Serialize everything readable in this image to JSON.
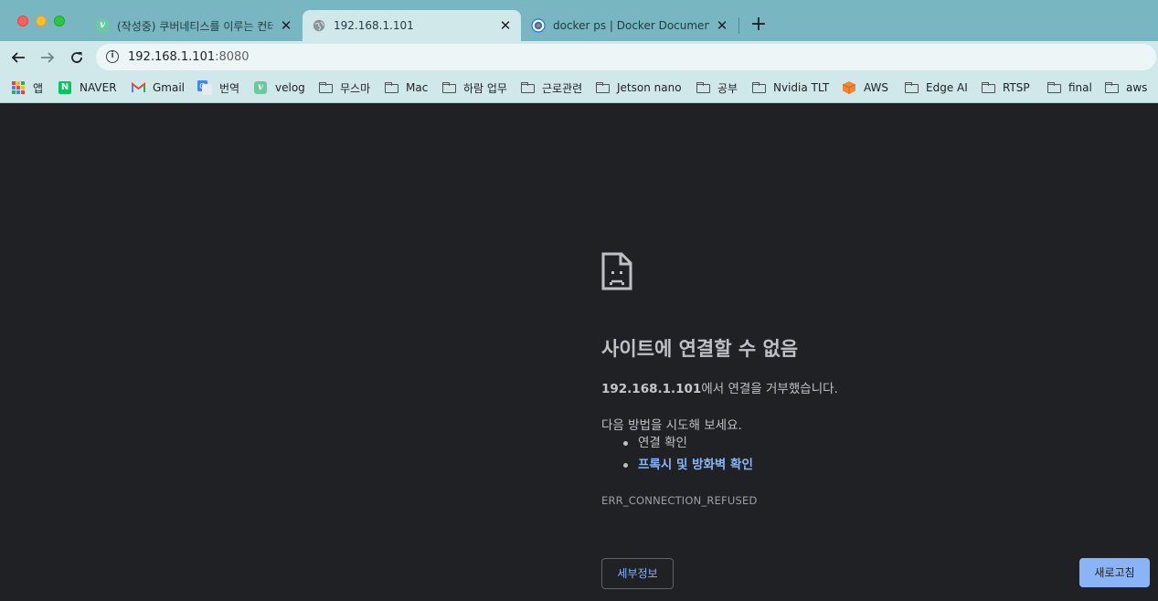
{
  "window": {
    "controls": [
      "close",
      "minimize",
      "zoom"
    ]
  },
  "tabs": [
    {
      "title": "(작성중) 쿠버네티스를 이루는 컨테이",
      "favicon": "velog-icon",
      "active": false
    },
    {
      "title": "192.168.1.101",
      "favicon": "globe-icon",
      "active": true
    },
    {
      "title": "docker ps | Docker Documenta",
      "favicon": "docker-docs-icon",
      "active": false
    }
  ],
  "toolbar": {
    "url_host": "192.168.1.101",
    "url_port": ":8080"
  },
  "bookmarks": [
    {
      "label": "앱",
      "icon": "apps-grid-icon"
    },
    {
      "label": "NAVER",
      "icon": "naver-icon"
    },
    {
      "label": "Gmail",
      "icon": "gmail-icon"
    },
    {
      "label": "번역",
      "icon": "google-translate-icon"
    },
    {
      "label": "velog",
      "icon": "velog-icon"
    },
    {
      "label": "무스마",
      "icon": "folder-icon"
    },
    {
      "label": "Mac",
      "icon": "folder-icon"
    },
    {
      "label": "하람 업무",
      "icon": "folder-icon"
    },
    {
      "label": "근로관련",
      "icon": "folder-icon"
    },
    {
      "label": "Jetson nano",
      "icon": "folder-icon"
    },
    {
      "label": "공부",
      "icon": "folder-icon"
    },
    {
      "label": "Nvidia TLT",
      "icon": "folder-icon"
    },
    {
      "label": "AWS",
      "icon": "aws-icon"
    },
    {
      "label": "Edge AI",
      "icon": "folder-icon"
    },
    {
      "label": "RTSP",
      "icon": "folder-icon"
    },
    {
      "label": "final",
      "icon": "folder-icon"
    },
    {
      "label": "aws",
      "icon": "folder-icon"
    }
  ],
  "error_page": {
    "icon": "sad-page-icon",
    "heading": "사이트에 연결할 수 없음",
    "host": "192.168.1.101",
    "desc_suffix": "에서 연결을 거부했습니다.",
    "try_text": "다음 방법을 시도해 보세요.",
    "suggestions": [
      {
        "label": "연결 확인",
        "is_link": false
      },
      {
        "label": "프록시 및 방화벽 확인",
        "is_link": true
      }
    ],
    "error_code": "ERR_CONNECTION_REFUSED",
    "details_label": "세부정보",
    "reload_label": "새로고침"
  },
  "colors": {
    "tabstrip": "#78b6c1",
    "toolbar": "#d1e8ea",
    "page_bg": "#202124",
    "link": "#8ab4f8",
    "text": "#bdc1c6"
  }
}
